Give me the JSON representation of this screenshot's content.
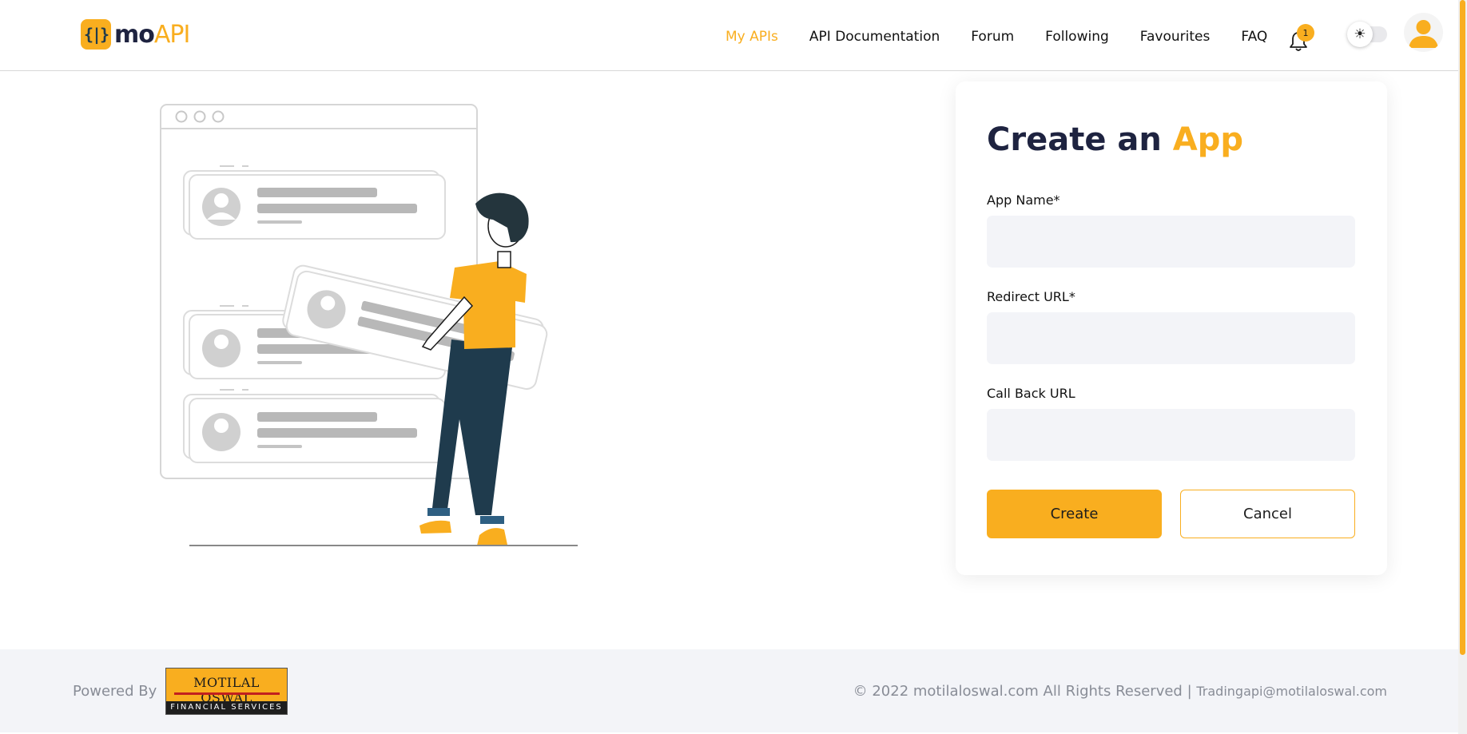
{
  "colors": {
    "accent": "#f9ae1f",
    "navy": "#1e2340",
    "footer_bg": "#f3f4f8"
  },
  "header": {
    "logo": {
      "badge": "{|}",
      "mo": "mo",
      "api": "API"
    },
    "nav": [
      {
        "label": "My APIs",
        "active": true
      },
      {
        "label": "API Documentation",
        "active": false
      },
      {
        "label": "Forum",
        "active": false
      },
      {
        "label": "Following",
        "active": false
      },
      {
        "label": "Favourites",
        "active": false
      },
      {
        "label": "FAQ",
        "active": false
      }
    ],
    "notifications_count": "1",
    "theme_icon": "☀"
  },
  "form": {
    "title_prefix": "Create an",
    "title_accent": "App",
    "fields": [
      {
        "label": "App Name*",
        "value": ""
      },
      {
        "label": "Redirect URL*",
        "value": ""
      },
      {
        "label": "Call Back URL",
        "value": ""
      }
    ],
    "create_label": "Create",
    "cancel_label": "Cancel"
  },
  "footer": {
    "powered_by": "Powered By",
    "partner_logo_top": "MOTILAL OSWAL",
    "partner_logo_bottom": "FINANCIAL SERVICES",
    "copyright": "© 2022 motilaloswal.com All Rights Reserved |",
    "email": "Tradingapi@motilaloswal.com"
  }
}
